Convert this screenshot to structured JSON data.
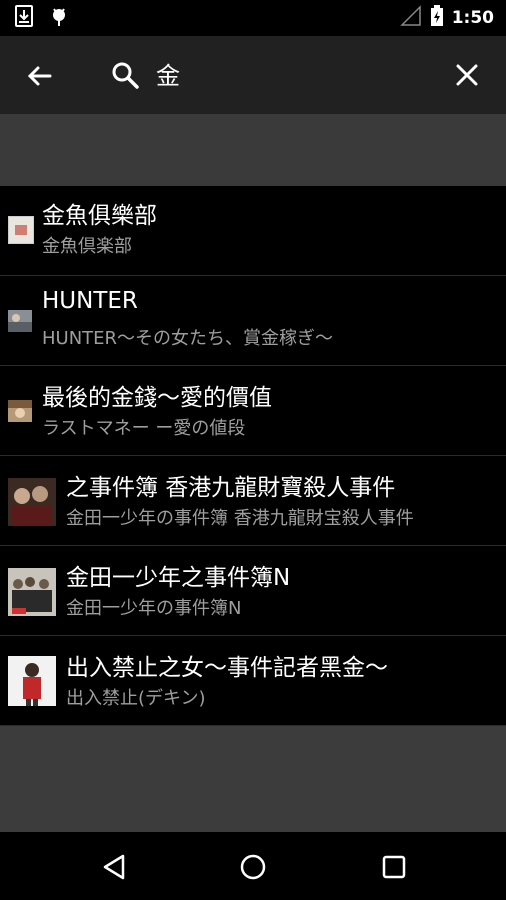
{
  "status_bar": {
    "time": "1:50",
    "icons": [
      "download-notification-icon",
      "android-debug-icon",
      "signal-icon",
      "battery-icon"
    ]
  },
  "search": {
    "query": "金"
  },
  "results": [
    {
      "title": "金魚俱樂部",
      "subtitle": "金魚倶楽部",
      "thumb": "small"
    },
    {
      "title": "HUNTER",
      "subtitle": "HUNTER〜その女たち、賞金稼ぎ〜",
      "thumb": "small"
    },
    {
      "title": "最後的金錢〜愛的價值",
      "subtitle": "ラストマネー ー愛の値段",
      "thumb": "small"
    },
    {
      "title": "之事件簿 香港九龍財寶殺人事件",
      "subtitle": "金田一少年の事件簿 香港九龍財宝殺人事件",
      "thumb": "large"
    },
    {
      "title": "金田一少年之事件簿N",
      "subtitle": "金田一少年の事件簿N",
      "thumb": "large"
    },
    {
      "title": "出入禁止之女〜事件記者黑金〜",
      "subtitle": "出入禁止(デキン)",
      "thumb": "large"
    }
  ],
  "colors": {
    "background": "#3c3c3c",
    "toolbar": "#212121",
    "list_item": "#000000",
    "subtitle": "#9e9e9e"
  }
}
